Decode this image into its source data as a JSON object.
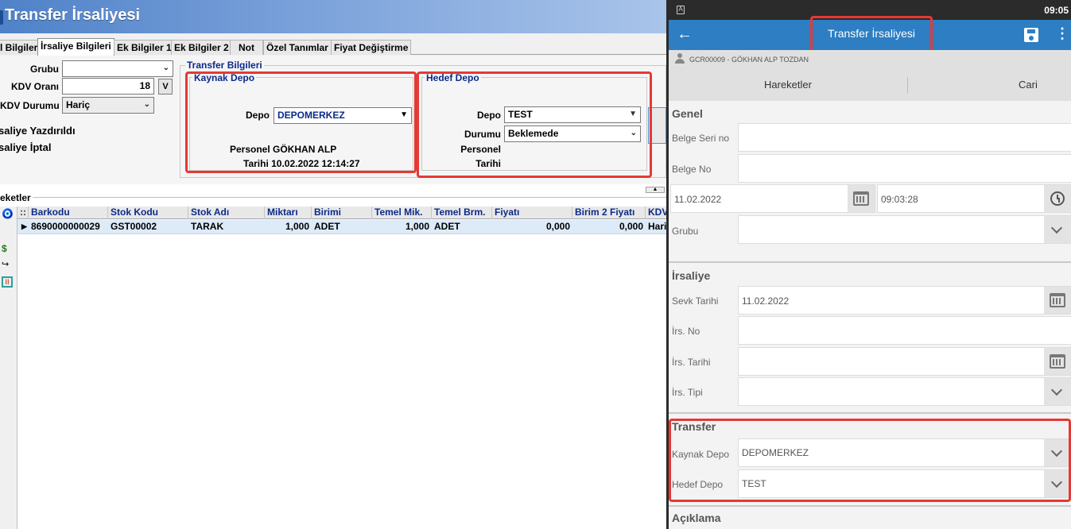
{
  "desktop": {
    "title": "Transfer İrsaliyesi",
    "tabs": [
      "l Bilgiler",
      "İrsaliye Bilgileri",
      "Ek Bilgiler 1",
      "Ek Bilgiler 2",
      "Not",
      "Özel Tanımlar",
      "Fiyat Değiştirme"
    ],
    "left_fields": {
      "grubu_label": "Grubu",
      "grubu_value": "",
      "kdv_orani_label": "KDV Oranı",
      "kdv_orani_value": "18",
      "v_button": "V",
      "kdv_durumu_label": "KDV Durumu",
      "kdv_durumu_value": "Hariç",
      "status_printed": "saliye Yazdırıldı",
      "status_cancel": "saliye İptal"
    },
    "transfer_group_title": "Transfer Bilgileri",
    "kaynak": {
      "title": "Kaynak Depo",
      "depo_label": "Depo",
      "depo_value": "DEPOMERKEZ",
      "personel_text": "Personel GÖKHAN ALP",
      "tarih_text": "Tarihi 10.02.2022 12:14:27"
    },
    "hedef": {
      "title": "Hedef Depo",
      "depo_label": "Depo",
      "depo_value": "TEST",
      "durumu_label": "Durumu",
      "durumu_value": "Beklemede",
      "personel_label": "Personel",
      "tarih_label": "Tarihi"
    },
    "grid": {
      "title": "eketler",
      "columns": [
        "Barkodu",
        "Stok Kodu",
        "Stok Adı",
        "Miktarı",
        "Birimi",
        "Temel Mik.",
        "Temel Brm.",
        "Fiyatı",
        "Birim 2 Fiyatı",
        "KDV"
      ],
      "rows": [
        [
          "8690000000029",
          "GST00002",
          "TARAK",
          "1,000",
          "ADET",
          "1,000",
          "ADET",
          "0,000",
          "0,000",
          "Hari"
        ]
      ]
    }
  },
  "mobile": {
    "status_time": "09:05",
    "title": "Transfer İrsaliyesi",
    "user": "GCR00009 - GÖKHAN ALP TOZDAN",
    "segments": [
      "Hareketler",
      "Cari"
    ],
    "genel": {
      "title": "Genel",
      "belge_seri_label": "Belge Seri no",
      "belge_seri_value": "",
      "belge_no_label": "Belge No",
      "belge_no_value": "",
      "date_value": "11.02.2022",
      "time_value": "09:03:28",
      "grubu_label": "Grubu",
      "grubu_value": ""
    },
    "irsaliye": {
      "title": "İrsaliye",
      "sevk_label": "Sevk Tarihi",
      "sevk_value": "11.02.2022",
      "irs_no_label": "İrs. No",
      "irs_tarihi_label": "İrs. Tarihi",
      "irs_tipi_label": "İrs. Tipi"
    },
    "transfer": {
      "title": "Transfer",
      "kaynak_label": "Kaynak Depo",
      "kaynak_value": "DEPOMERKEZ",
      "hedef_label": "Hedef Depo",
      "hedef_value": "TEST"
    },
    "aciklama_title": "Açıklama"
  },
  "colors": {
    "highlight_red": "#e53935",
    "app_blue": "#2d7ec3",
    "title_blue": "#4f82c8",
    "column_header_text": "#0a2a8a"
  }
}
